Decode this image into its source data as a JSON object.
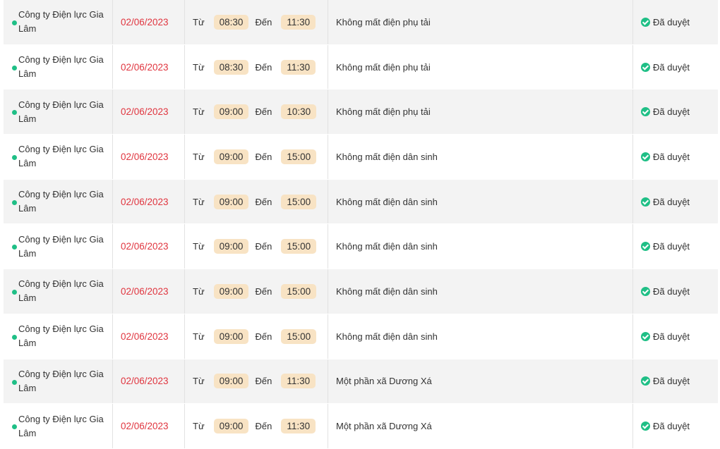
{
  "table": {
    "rows": [
      {
        "unit": "Công ty Điện lực Gia Lâm",
        "date": "02/06/2023",
        "from_label": "Từ",
        "from": "08:30",
        "to_label": "Đến",
        "to": "11:30",
        "description": "Không mất điện phụ tải",
        "status": "Đã duyệt"
      },
      {
        "unit": "Công ty Điện lực Gia Lâm",
        "date": "02/06/2023",
        "from_label": "Từ",
        "from": "08:30",
        "to_label": "Đến",
        "to": "11:30",
        "description": "Không mất điện phụ tải",
        "status": "Đã duyệt"
      },
      {
        "unit": "Công ty Điện lực Gia Lâm",
        "date": "02/06/2023",
        "from_label": "Từ",
        "from": "09:00",
        "to_label": "Đến",
        "to": "10:30",
        "description": "Không mất điện phụ tải",
        "status": "Đã duyệt"
      },
      {
        "unit": "Công ty Điện lực Gia Lâm",
        "date": "02/06/2023",
        "from_label": "Từ",
        "from": "09:00",
        "to_label": "Đến",
        "to": "15:00",
        "description": "Không mất điện dân sinh",
        "status": "Đã duyệt"
      },
      {
        "unit": "Công ty Điện lực Gia Lâm",
        "date": "02/06/2023",
        "from_label": "Từ",
        "from": "09:00",
        "to_label": "Đến",
        "to": "15:00",
        "description": "Không mất điện dân sinh",
        "status": "Đã duyệt"
      },
      {
        "unit": "Công ty Điện lực Gia Lâm",
        "date": "02/06/2023",
        "from_label": "Từ",
        "from": "09:00",
        "to_label": "Đến",
        "to": "15:00",
        "description": "Không mất điện dân sinh",
        "status": "Đã duyệt"
      },
      {
        "unit": "Công ty Điện lực Gia Lâm",
        "date": "02/06/2023",
        "from_label": "Từ",
        "from": "09:00",
        "to_label": "Đến",
        "to": "15:00",
        "description": "Không mất điện dân sinh",
        "status": "Đã duyệt"
      },
      {
        "unit": "Công ty Điện lực Gia Lâm",
        "date": "02/06/2023",
        "from_label": "Từ",
        "from": "09:00",
        "to_label": "Đến",
        "to": "15:00",
        "description": "Không mất điện dân sinh",
        "status": "Đã duyệt"
      },
      {
        "unit": "Công ty Điện lực Gia Lâm",
        "date": "02/06/2023",
        "from_label": "Từ",
        "from": "09:00",
        "to_label": "Đến",
        "to": "11:30",
        "description": "Một phần xã Dương Xá",
        "status": "Đã duyệt"
      },
      {
        "unit": "Công ty Điện lực Gia Lâm",
        "date": "02/06/2023",
        "from_label": "Từ",
        "from": "09:00",
        "to_label": "Đến",
        "to": "11:30",
        "description": "Một phần xã Dương Xá",
        "status": "Đã duyệt"
      }
    ]
  },
  "icons": {
    "unit_marker": "green-dot-icon",
    "status": "check-circle-icon"
  },
  "colors": {
    "date": "#e0353f",
    "status_green": "#1fbf86",
    "time_badge": "#f8e3c4",
    "row_alt": "#f3f3f3"
  }
}
